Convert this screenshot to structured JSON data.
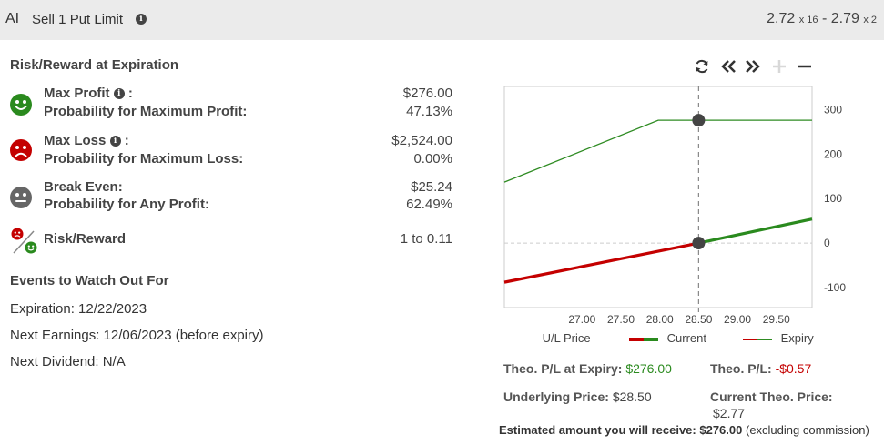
{
  "header": {
    "symbol": "AI",
    "order": "Sell 1 Put Limit",
    "bid": "2.72",
    "bid_size": "x 16",
    "separator": "-",
    "ask": "2.79",
    "ask_size": "x 2"
  },
  "risk": {
    "title": "Risk/Reward at Expiration",
    "max_profit_label": "Max Profit",
    "max_profit_value": "$276.00",
    "prob_max_profit_label": "Probability for Maximum Profit:",
    "prob_max_profit_value": "47.13%",
    "max_loss_label": "Max Loss",
    "max_loss_value": "$2,524.00",
    "prob_max_loss_label": "Probability for Maximum Loss:",
    "prob_max_loss_value": "0.00%",
    "break_even_label": "Break Even:",
    "break_even_value": "$25.24",
    "prob_any_profit_label": "Probability for Any Profit:",
    "prob_any_profit_value": "62.49%",
    "risk_reward_label": "Risk/Reward",
    "risk_reward_value": "1 to 0.11",
    "colon": ":"
  },
  "events": {
    "title": "Events to Watch Out For",
    "expiration": "Expiration: 12/22/2023",
    "earnings": "Next Earnings: 12/06/2023 (before expiry)",
    "dividend": "Next Dividend: N/A"
  },
  "toolbar": {
    "refresh_icon": "refresh-icon",
    "prev_icon": "double-chevron-left-icon",
    "next_icon": "double-chevron-right-icon",
    "zoom_in_icon": "plus-icon",
    "zoom_out_icon": "minus-icon"
  },
  "chart_data": {
    "type": "line",
    "x_ticks": [
      "27.00",
      "27.50",
      "28.00",
      "28.50",
      "29.00",
      "29.50"
    ],
    "y_ticks": [
      "300",
      "200",
      "100",
      "0",
      "-100"
    ],
    "xlim": [
      26.0,
      29.96
    ],
    "ylim": [
      -145,
      352
    ],
    "underlying_price": 28.5,
    "series": [
      {
        "name": "Expiry",
        "color": "#2e8b22",
        "x": [
          26.0,
          27.98,
          29.96
        ],
        "y": [
          137,
          276,
          276
        ]
      },
      {
        "name": "Current",
        "color": "#c40000",
        "x": [
          26.0,
          28.5
        ],
        "y": [
          -88,
          0
        ]
      },
      {
        "name": "Current",
        "color": "#2a8a1e",
        "x": [
          28.5,
          29.96
        ],
        "y": [
          0,
          54
        ]
      }
    ],
    "markers": [
      {
        "x": 28.5,
        "y": 276
      },
      {
        "x": 28.5,
        "y": 0
      }
    ],
    "legend": {
      "ul_price": "U/L Price",
      "current": "Current",
      "expiry": "Expiry"
    }
  },
  "stats": {
    "theo_pl_expiry_label": "Theo. P/L at Expiry:",
    "theo_pl_expiry_value": "$276.00",
    "theo_pl_label": "Theo. P/L:",
    "theo_pl_value": "-$0.57",
    "underlying_label": "Underlying Price:",
    "underlying_value": "$28.50",
    "current_theo_label": "Current Theo. Price:",
    "current_theo_value": "$2.77"
  },
  "footer": {
    "estimate_prefix": "Estimated amount you will receive:",
    "estimate_value": "$276.00",
    "estimate_suffix": "(excluding commission)"
  }
}
